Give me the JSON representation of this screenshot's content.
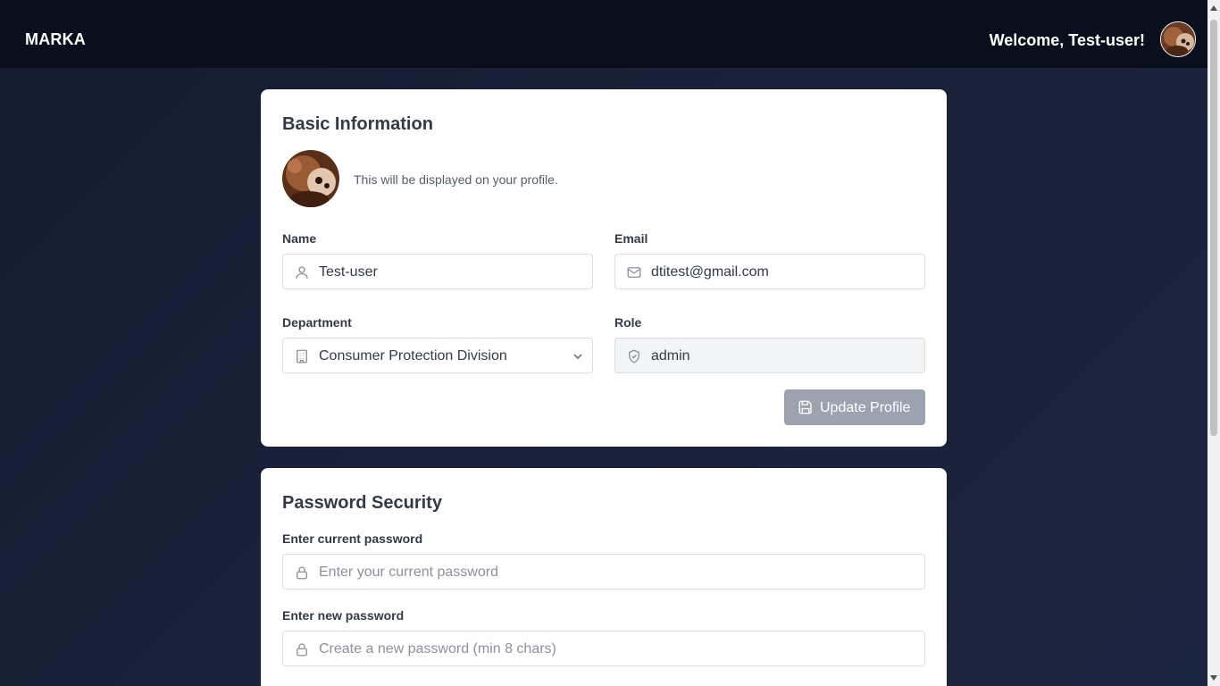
{
  "header": {
    "brand": "MARKA",
    "welcome": "Welcome, Test-user!"
  },
  "basic_info": {
    "title": "Basic Information",
    "profile_note": "This will be displayed on your profile.",
    "name": {
      "label": "Name",
      "value": "Test-user",
      "icon": "user-icon"
    },
    "email": {
      "label": "Email",
      "value": "dtitest@gmail.com",
      "icon": "mail-icon"
    },
    "department": {
      "label": "Department",
      "value": "Consumer Protection Division",
      "icon": "building-icon"
    },
    "role": {
      "label": "Role",
      "value": "admin",
      "icon": "shield-icon"
    },
    "update_button": "Update Profile"
  },
  "password_security": {
    "title": "Password Security",
    "current": {
      "label": "Enter current password",
      "placeholder": "Enter your current password",
      "icon": "lock-icon"
    },
    "new": {
      "label": "Enter new password",
      "placeholder": "Create a new password (min 8 chars)",
      "icon": "lock-icon"
    }
  },
  "colors": {
    "topbar": "#0a0f1d",
    "page_bg": "#1a2138",
    "card_bg": "#ffffff",
    "button_disabled": "#9ca3af"
  }
}
